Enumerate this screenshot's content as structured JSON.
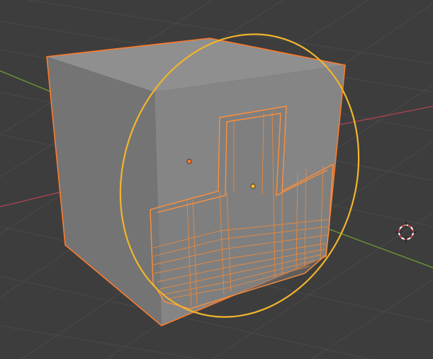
{
  "viewport": {
    "mode": "wireframe-edit-overlay",
    "colors": {
      "background": "#3d3d3d",
      "grid": "#4a4a4a",
      "axis_x": "#b04452",
      "axis_y": "#6f9a2f",
      "selection_outline": "#ff7a2a",
      "edge": "#ff8f3b",
      "edge_dim": "#e8893e",
      "circle_select": "#f2b52b",
      "cube_front": "#858585",
      "cube_top": "#8f8f8f",
      "cube_side": "#6f6f6f",
      "inner_face": "#7a7a7a"
    },
    "icons": {
      "origin_point": "origin-dot-icon",
      "pivot": "pivot-dot-icon",
      "cursor": "3d-cursor-icon"
    }
  }
}
